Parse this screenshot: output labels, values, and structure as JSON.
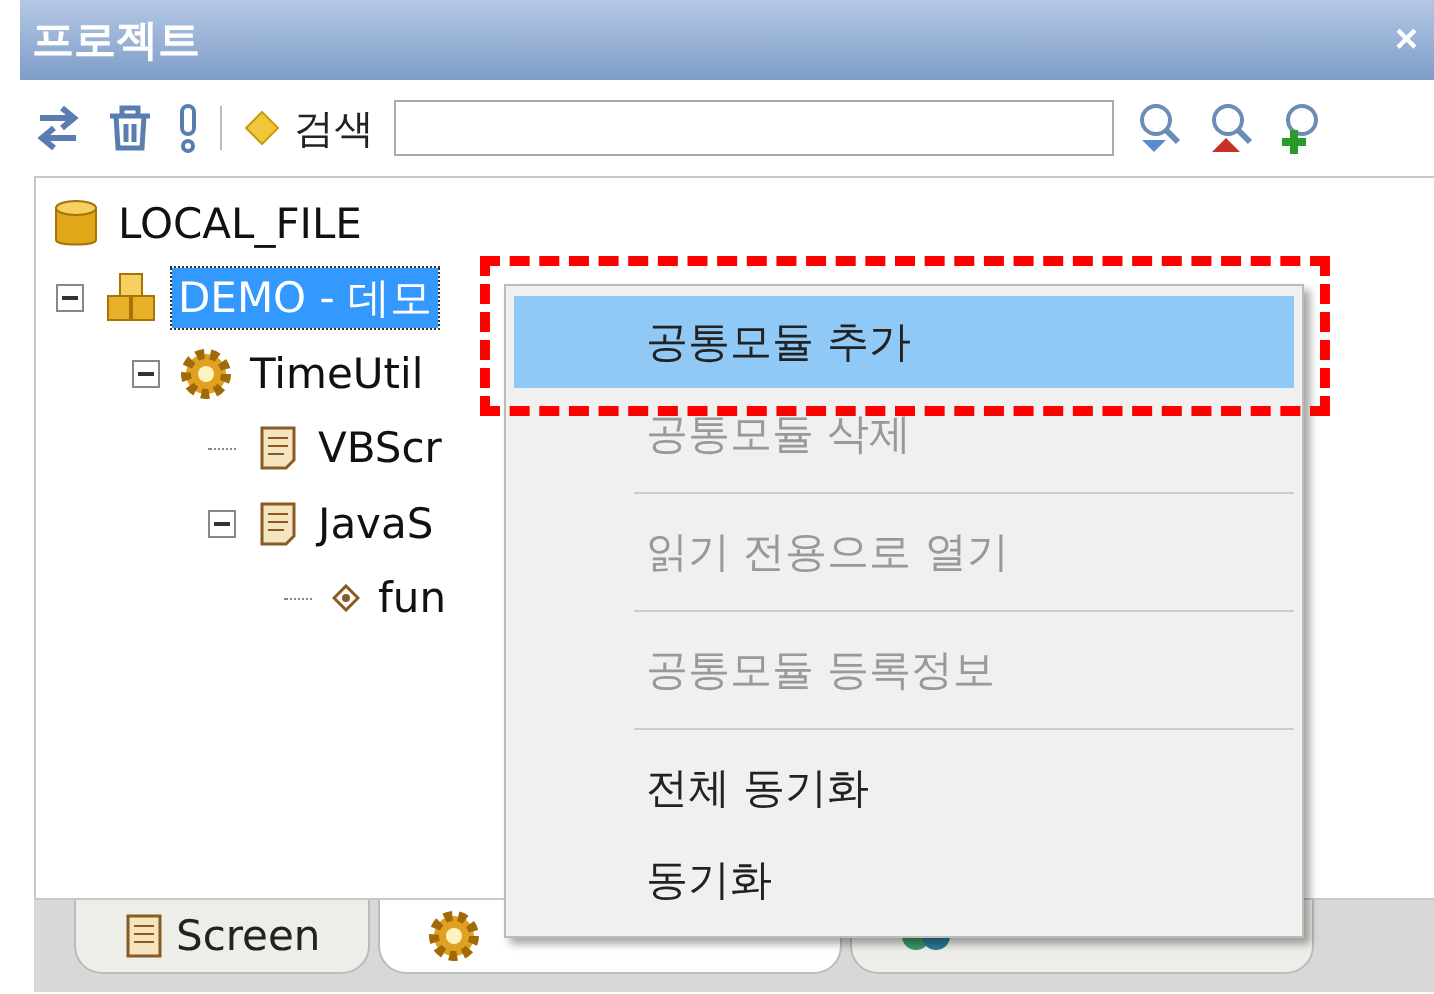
{
  "panel": {
    "title": "프로젝트",
    "close": "×"
  },
  "toolbar": {
    "search_label": "검색"
  },
  "tree": [
    {
      "label": "LOCAL_FILE",
      "kind": "database",
      "children": [
        {
          "label": "DEMO - 데모",
          "kind": "project",
          "expanded": true,
          "selected": true,
          "children": [
            {
              "label": "TimeUtil",
              "kind": "module",
              "expanded": true,
              "selected": false,
              "children": [
                {
                  "label": "VBScr",
                  "kind": "script",
                  "selected": false
                },
                {
                  "label": "JavaS",
                  "kind": "script",
                  "expanded": true,
                  "selected": false,
                  "children": [
                    {
                      "label": "fun",
                      "kind": "function",
                      "selected": false
                    }
                  ]
                }
              ]
            }
          ]
        }
      ]
    }
  ],
  "tabs": [
    {
      "label": "Screen",
      "kind": "screen",
      "selected": false
    },
    {
      "kind": "module",
      "selected": true
    },
    {
      "kind": "dataset",
      "selected": false
    }
  ],
  "context_menu": {
    "items": [
      {
        "label": "공통모듈 추가",
        "selected": true,
        "disabled": false,
        "separator_before": false
      },
      {
        "label": "공통모듈 삭제",
        "selected": false,
        "disabled": true,
        "separator_before": false
      },
      {
        "label": "읽기 전용으로 열기",
        "selected": false,
        "disabled": true,
        "separator_before": true
      },
      {
        "label": "공통모듈 등록정보",
        "selected": false,
        "disabled": true,
        "separator_before": true
      },
      {
        "label": "전체 동기화",
        "selected": false,
        "disabled": false,
        "separator_before": true
      },
      {
        "label": "동기화",
        "selected": false,
        "disabled": false,
        "separator_before": false
      }
    ]
  }
}
